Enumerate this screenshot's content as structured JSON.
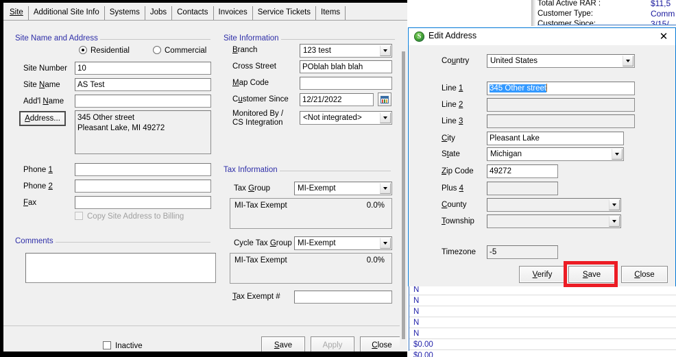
{
  "app": {
    "main_window_title": "Site",
    "tabs": [
      {
        "label": "Site",
        "accel": "S",
        "active": true
      },
      {
        "label": "Additional Site Info",
        "active": false
      },
      {
        "label": "Systems",
        "active": false
      },
      {
        "label": "Jobs",
        "active": false
      },
      {
        "label": "Contacts",
        "active": false
      },
      {
        "label": "Invoices",
        "active": false
      },
      {
        "label": "Service Tickets",
        "active": false
      },
      {
        "label": "Items",
        "active": false
      }
    ]
  },
  "site_name_and_address": {
    "group_title": "Site Name and Address",
    "radios": [
      {
        "label": "Residential",
        "selected": true
      },
      {
        "label": "Commercial",
        "selected": false
      }
    ],
    "fields": {
      "site_number_label": "Site Number",
      "site_number_value": "10",
      "site_name_label": "Site Name",
      "site_name_value": "AS Test",
      "addl_name_label": "Add'l Name",
      "addl_name_value": "",
      "address_button_label": "Address...",
      "address_value": "345 Other street\nPleasant Lake, MI  49272",
      "phone1_label": "Phone 1",
      "phone1_value": "",
      "phone2_label": "Phone 2",
      "phone2_value": "",
      "fax_label": "Fax",
      "fax_value": ""
    },
    "copy_to_billing": {
      "label": "Copy Site Address to Billing",
      "checked": false,
      "disabled": true
    }
  },
  "comments": {
    "group_title": "Comments",
    "value": ""
  },
  "site_information": {
    "group_title": "Site Information",
    "branch_label": "Branch",
    "branch_value": "123 test",
    "cross_street_label": "Cross Street",
    "cross_street_value": "POblah blah blah",
    "map_code_label": "Map Code",
    "map_code_value": "",
    "customer_since_label": "Customer Since",
    "customer_since_value": "12/21/2022",
    "monitored_by_label_line1": "Monitored By /",
    "monitored_by_label_line2": "CS Integration",
    "monitored_by_value": "<Not integrated>"
  },
  "tax_information": {
    "group_title": "Tax Information",
    "tax_group_label": "Tax Group",
    "tax_group_value": "MI-Exempt",
    "tax_group_detail_name": "MI-Tax Exempt",
    "tax_group_detail_rate": "0.0%",
    "cycle_tax_group_label": "Cycle Tax Group",
    "cycle_tax_group_value": "MI-Exempt",
    "cycle_tax_detail_name": "MI-Tax Exempt",
    "cycle_tax_detail_rate": "0.0%",
    "tax_exempt_label": "Tax Exempt #",
    "tax_exempt_value": ""
  },
  "main_footer": {
    "inactive_label": "Inactive",
    "inactive_checked": false,
    "save_label": "Save",
    "apply_label": "Apply",
    "apply_disabled": true,
    "close_label": "Close"
  },
  "dialog": {
    "title": "Edit Address",
    "icon": "shopper-s-icon",
    "close_icon": "close-icon",
    "country_label": "Country",
    "country_value": "United States",
    "line1_label": "Line 1",
    "line1_value": "345 Other street",
    "line1_selected": true,
    "line2_label": "Line 2",
    "line2_value": "",
    "line3_label": "Line 3",
    "line3_value": "",
    "city_label": "City",
    "city_value": "Pleasant Lake",
    "state_label": "State",
    "state_value": "Michigan",
    "zip_label": "Zip Code",
    "zip_value": "49272",
    "plus4_label": "Plus 4",
    "plus4_value": "",
    "county_label": "County",
    "county_value": "",
    "county_disabled": true,
    "township_label": "Township",
    "township_value": "",
    "township_disabled": true,
    "timezone_label": "Timezone",
    "timezone_value": "-5",
    "verify_label": "Verify",
    "save_label": "Save",
    "close_label": "Close"
  },
  "background": {
    "customer_summary": [
      {
        "label": "Total Active RAR :",
        "value": "$11,5"
      },
      {
        "label": "Customer Type:",
        "value": "Comm"
      },
      {
        "label": "Customer Since:",
        "value": "3/15/"
      }
    ],
    "list_rows": [
      "N",
      "N",
      "N",
      "N",
      "N",
      "$0.00",
      "$0.00"
    ]
  },
  "annotation": {
    "target": "dialog-save-button",
    "color": "#ec1c24"
  }
}
